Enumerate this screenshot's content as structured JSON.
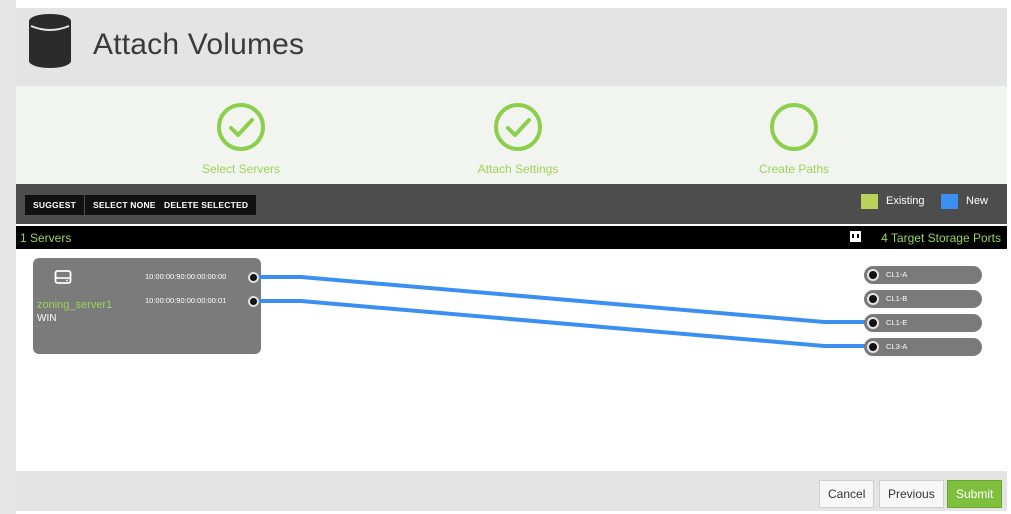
{
  "header": {
    "title": "Attach Volumes",
    "icon": "database-icon"
  },
  "steps": [
    {
      "label": "Select Servers",
      "state": "complete"
    },
    {
      "label": "Attach Settings",
      "state": "complete"
    },
    {
      "label": "Create Paths",
      "state": "current"
    }
  ],
  "toolbar": {
    "suggest": "SUGGEST",
    "select_none": "SELECT NONE",
    "delete_selected": "DELETE SELECTED",
    "legend": [
      {
        "label": "Existing",
        "color": "#b8d25a"
      },
      {
        "label": "New",
        "color": "#3b8ff0"
      }
    ]
  },
  "countbar": {
    "servers": "1 Servers",
    "targets": "4 Target Storage Ports"
  },
  "server": {
    "name": "zoning_server1",
    "os": "WIN",
    "wwns": [
      "10:00:00:90:00:00:00:00",
      "10:00:00:90:00:00:00:01"
    ]
  },
  "target_ports": [
    "CL1-A",
    "CL1-B",
    "CL1-E",
    "CL3-A"
  ],
  "paths": [
    {
      "from": "10:00:00:90:00:00:00:00",
      "to": "CL1-E",
      "type": "New"
    },
    {
      "from": "10:00:00:90:00:00:00:01",
      "to": "CL3-A",
      "type": "New"
    }
  ],
  "colors": {
    "accent_green": "#9cd35a",
    "new_path": "#3b8ff0",
    "submit": "#7fbf3e"
  },
  "footer": {
    "cancel": "Cancel",
    "previous": "Previous",
    "submit": "Submit"
  }
}
